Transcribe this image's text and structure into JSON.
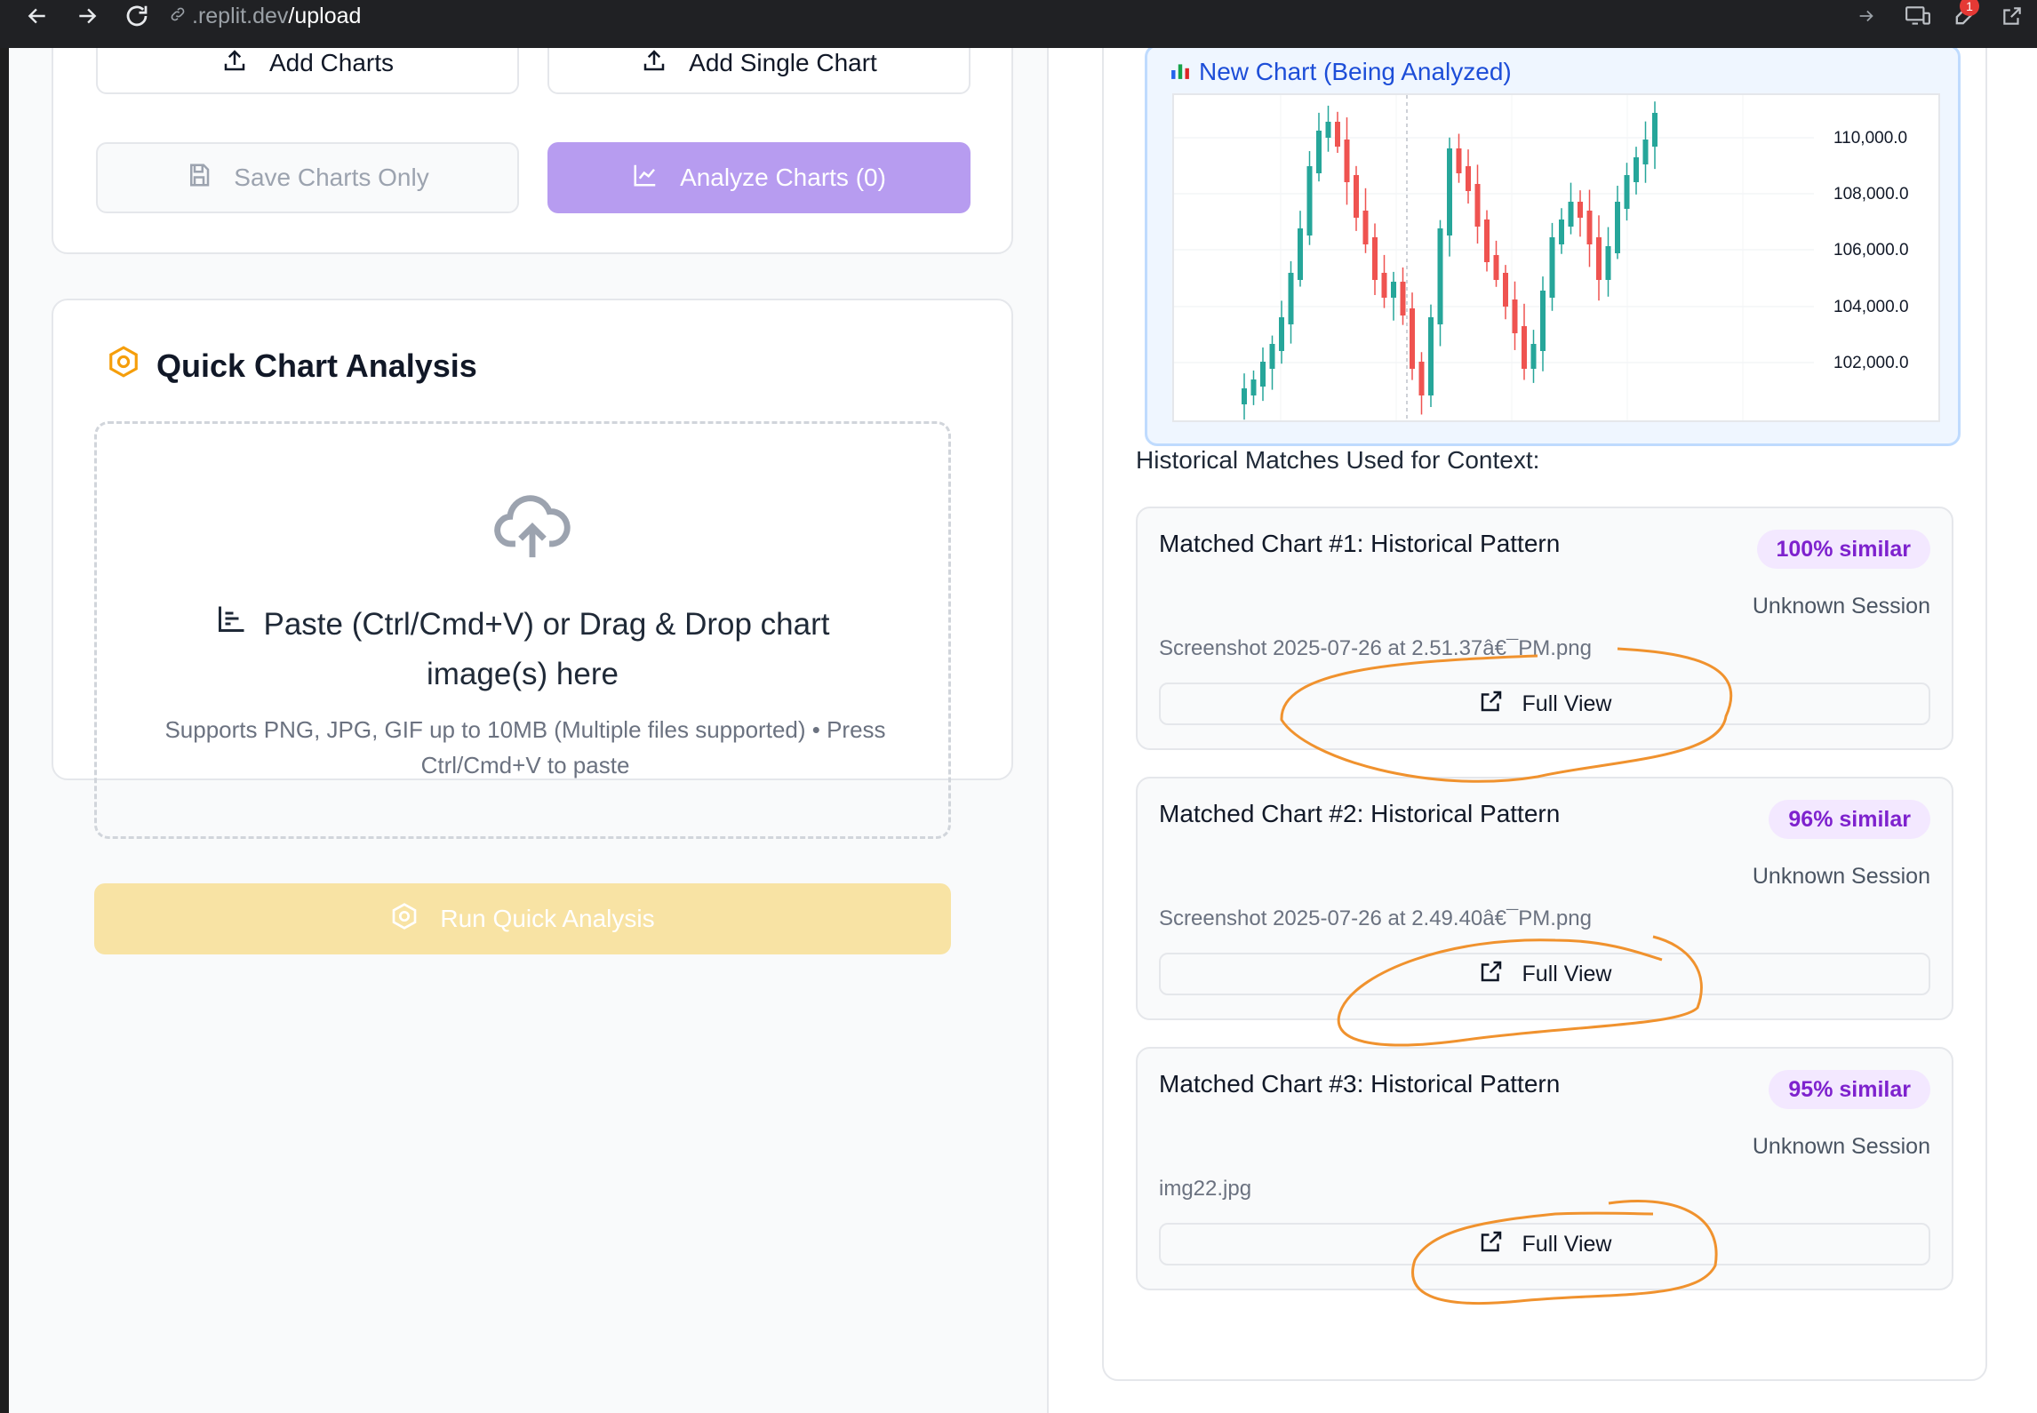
{
  "browser": {
    "url_host": ".replit.dev",
    "url_path": "/upload",
    "notification_count": "1"
  },
  "top_card": {
    "add_charts_label": "Add Charts",
    "add_single_chart_label": "Add Single Chart",
    "save_charts_only_label": "Save Charts Only",
    "analyze_charts_label": "Analyze Charts (0)"
  },
  "quick_analysis": {
    "title": "Quick Chart Analysis",
    "drop_line1": "Paste (Ctrl/Cmd+V) or Drag & Drop chart",
    "drop_line2": "image(s) here",
    "drop_hint": "Supports PNG, JPG, GIF up to 10MB (Multiple files supported) • Press Ctrl/Cmd+V to paste",
    "run_label": "Run Quick Analysis"
  },
  "new_chart": {
    "title": "New Chart (Being Analyzed)",
    "y_ticks": [
      "110,000.0",
      "108,000.0",
      "106,000.0",
      "104,000.0",
      "102,000.0"
    ]
  },
  "historical": {
    "label": "Historical Matches Used for Context:",
    "matches": [
      {
        "title": "Matched Chart #1: Historical Pattern",
        "similarity": "100% similar",
        "session": "Unknown Session",
        "filename": "Screenshot 2025-07-26 at 2.51.37â€¯PM.png",
        "button": "Full View"
      },
      {
        "title": "Matched Chart #2: Historical Pattern",
        "similarity": "96% similar",
        "session": "Unknown Session",
        "filename": "Screenshot 2025-07-26 at 2.49.40â€¯PM.png",
        "button": "Full View"
      },
      {
        "title": "Matched Chart #3: Historical Pattern",
        "similarity": "95% similar",
        "session": "Unknown Session",
        "filename": "img22.jpg",
        "button": "Full View"
      }
    ]
  },
  "colors": {
    "accent_purple": "#b79cf0",
    "run_yellow": "#f8e3a4",
    "candle_up": "#26a69a",
    "candle_down": "#ef5350",
    "annotation": "#f0922e",
    "similar_badge": "#7e22ce"
  },
  "icons": [
    "back-icon",
    "forward-icon",
    "reload-icon",
    "link-icon",
    "upload-icon",
    "save-icon",
    "chart-line-icon",
    "hexagon-icon",
    "cloud-upload-icon",
    "bar-chart-icon",
    "external-link-icon"
  ]
}
